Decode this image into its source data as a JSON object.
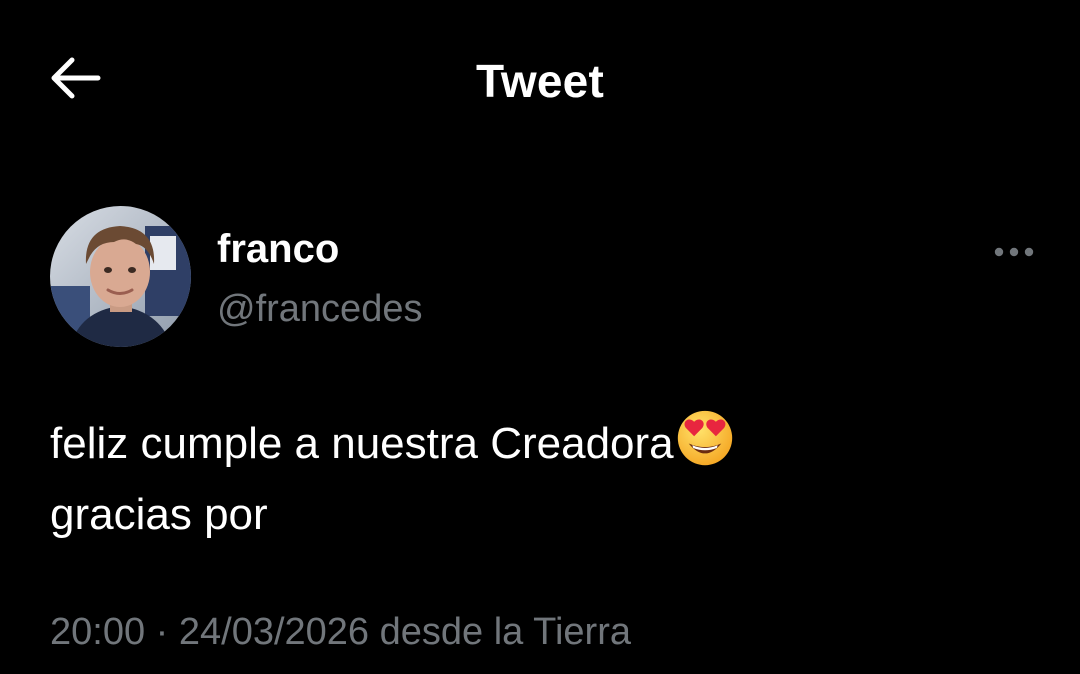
{
  "header": {
    "title": "Tweet",
    "back_icon": "arrow-left-icon"
  },
  "author": {
    "name": "franco",
    "handle": "@francedes",
    "avatar_icon": "profile-photo",
    "more_icon": "more-horizontal-icon"
  },
  "tweet": {
    "line1": "feliz cumple a nuestra Creadora",
    "line1_emoji": "smiling-face-with-heart-eyes-emoji",
    "line2": "gracias por"
  },
  "meta": {
    "time": "20:00",
    "separator": "·",
    "date": "24/03/2026",
    "source": "desde la Tierra"
  },
  "colors": {
    "background": "#000000",
    "primary_text": "#ffffff",
    "secondary_text": "#71767b"
  }
}
